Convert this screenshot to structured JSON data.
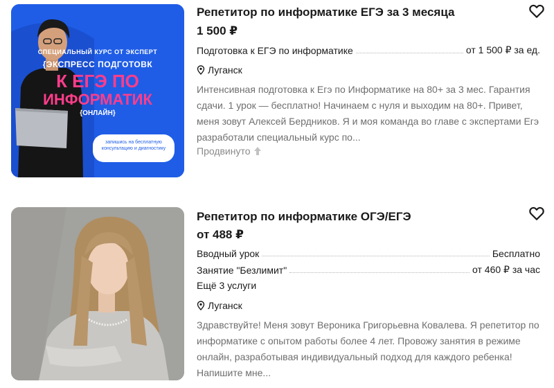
{
  "listings": [
    {
      "title": "Репетитор по информатике ЕГЭ за 3 месяца",
      "price": "1 500 ₽",
      "services": [
        {
          "name": "Подготовка к ЕГЭ по информатике",
          "price": "от 1 500 ₽ за ед."
        }
      ],
      "location": "Луганск",
      "description": "Интенсивная подготовка к Егэ по Информатике на 80+ за 3 мес. Гарантия сдачи. 1 урок — бесплатно! Начинаем с нуля и выходим на 80+. Привет, меня зовут Алексей Бердников. Я и моя команда во главе с экспертами Егэ разработали специальный курс по...",
      "promoted": "Продвинуто",
      "image_text": {
        "line1": "СПЕЦИАЛЬНЫЙ КУРС ОТ ЭКСПЕРТ",
        "line2": "{ЭКСПРЕСС ПОДГОТОВК",
        "line3": "К ЕГЭ ПО",
        "line4": "ИНФОРМАТИК",
        "line5": "{ОНЛАЙН}",
        "cta": "запишись на бесплатную консультацию и диагностику"
      }
    },
    {
      "title": "Репетитор по информатике ОГЭ/ЕГЭ",
      "price": "от 488 ₽",
      "services": [
        {
          "name": "Вводный урок",
          "price": "Бесплатно"
        },
        {
          "name": "Занятие \"Безлимит\"",
          "price": "от 460 ₽ за час"
        }
      ],
      "more_services": "Ещё 3 услуги",
      "location": "Луганск",
      "description": "Здравствуйте! Меня зовут Вероника Григорьевна Ковалева. Я репетитор по информатике с опытом работы более 4 лет. Провожу занятия в режиме онлайн, разработывая индивидуальный подход для каждого ребенка! Напишите мне..."
    }
  ],
  "icons": {
    "favorite": "heart-outline-icon",
    "location": "location-pin-icon",
    "promoted": "arrow-up-icon"
  },
  "colors": {
    "thumb1_bg": "#1f5de6",
    "thumb1_accent": "#ff3d8b",
    "muted_text": "#6e6e6e"
  }
}
